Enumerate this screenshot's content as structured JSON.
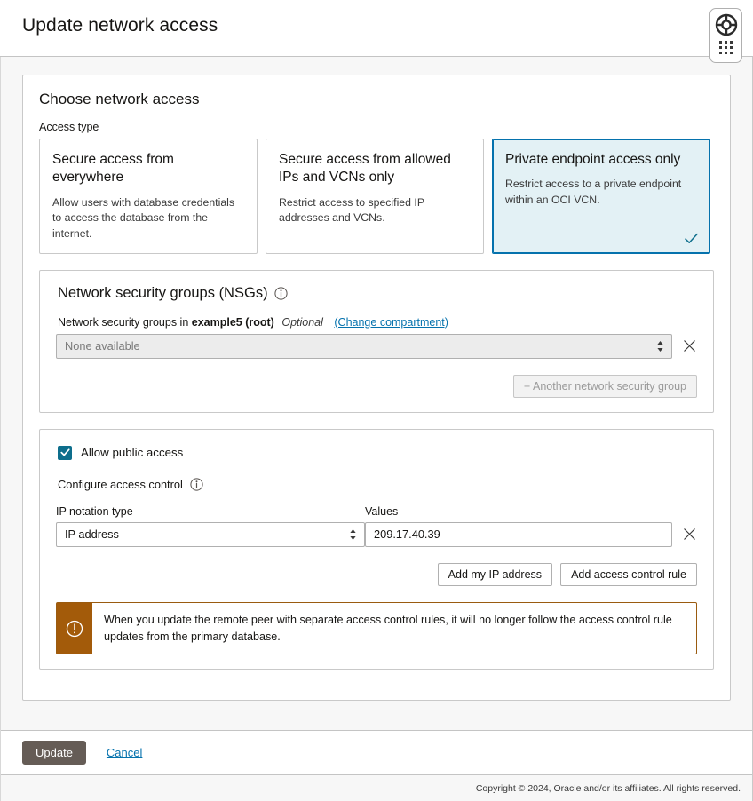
{
  "header": {
    "title": "Update network access",
    "help_icon": "lifebuoy-icon",
    "apps_icon": "grid-dots-icon"
  },
  "panel": {
    "title": "Choose network access",
    "access_type_label": "Access type",
    "cards": [
      {
        "title": "Secure access from everywhere",
        "description": "Allow users with database credentials to access the database from the internet.",
        "selected": false
      },
      {
        "title": "Secure access from allowed IPs and VCNs only",
        "description": "Restrict access to specified IP addresses and VCNs.",
        "selected": false
      },
      {
        "title": "Private endpoint access only",
        "description": "Restrict access to a private endpoint within an OCI VCN.",
        "selected": true
      }
    ]
  },
  "nsg": {
    "title": "Network security groups (NSGs)",
    "info_icon": "info-icon",
    "label_prefix": "Network security groups in",
    "compartment": "example5 (root)",
    "optional": "Optional",
    "change_link": "(Change compartment)",
    "select_value": "None available",
    "remove_icon": "close-x-icon",
    "add_button": "+ Another network security group",
    "add_button_disabled": true
  },
  "access_control": {
    "allow_public_label": "Allow public access",
    "allow_public_checked": true,
    "configure_label": "Configure access control",
    "info_icon": "info-icon",
    "notation_label": "IP notation type",
    "notation_value": "IP address",
    "values_label": "Values",
    "values_value": "209.17.40.39",
    "remove_icon": "close-x-icon",
    "add_my_ip_button": "Add my IP address",
    "add_rule_button": "Add access control rule",
    "warning_icon": "warning-exclamation-icon",
    "warning_text": "When you update the remote peer with separate access control rules, it will no longer follow the access control rule updates from the primary database."
  },
  "footer": {
    "update_button": "Update",
    "cancel_link": "Cancel",
    "copyright": "Copyright © 2024, Oracle and/or its affiliates. All rights reserved."
  },
  "colors": {
    "accent_link": "#0572ad",
    "selected_card_bg": "#e3f1f5",
    "selected_card_border": "#0572ad",
    "checkbox_fill": "#0d6e8c",
    "warning_bar": "#a35b0a",
    "primary_button": "#655c56"
  }
}
